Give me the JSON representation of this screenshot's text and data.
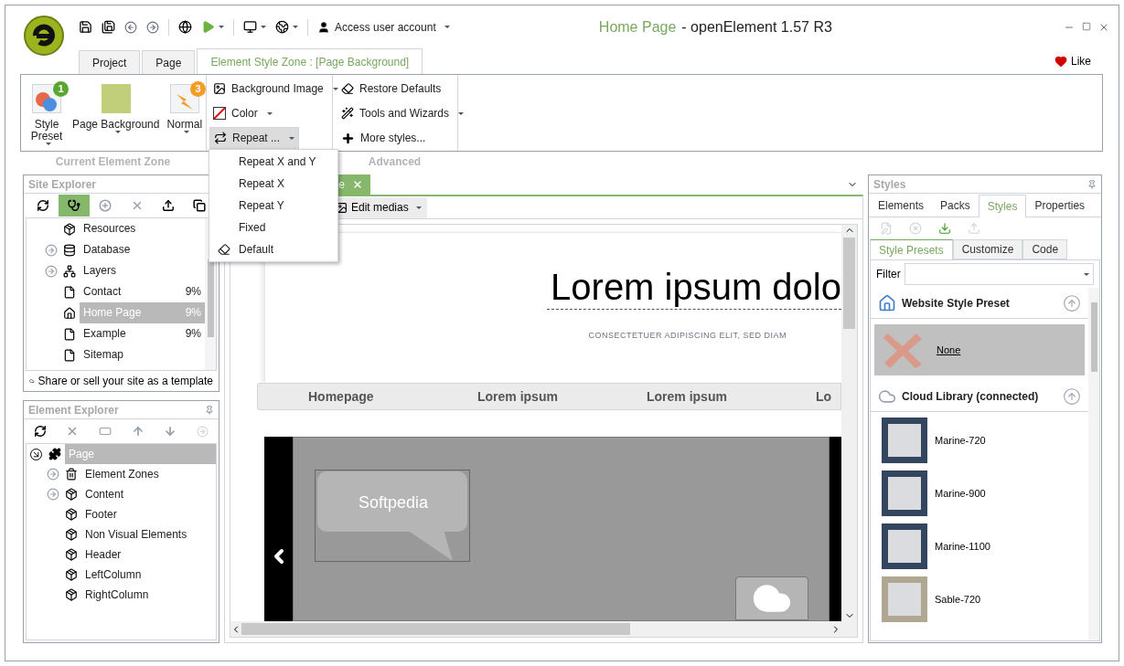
{
  "title": {
    "page": "Home Page",
    "app": "- openElement 1.57 R3"
  },
  "toolbar": {
    "account": "Access user account"
  },
  "tabs": [
    {
      "label": "Project",
      "selected": false
    },
    {
      "label": "Page",
      "selected": false
    },
    {
      "label": "Element Style Zone : [Page Background]",
      "selected": true
    }
  ],
  "like": "Like",
  "ribbon": {
    "big_buttons": [
      {
        "kind": "preset",
        "label": "Style Preset",
        "badge": "1"
      },
      {
        "kind": "swatch",
        "label": "Page Background"
      },
      {
        "kind": "normal",
        "label": "Normal",
        "badge": "3"
      }
    ],
    "style_buttons": [
      {
        "kind": "image",
        "label": "Background Image",
        "pressed": false
      },
      {
        "kind": "color",
        "label": "Color",
        "pressed": false
      },
      {
        "kind": "repeat",
        "label": "Repeat ...",
        "pressed": true
      }
    ],
    "advanced_buttons": [
      {
        "kind": "eraser",
        "label": "Restore Defaults"
      },
      {
        "kind": "wand",
        "label": "Tools and Wizards"
      },
      {
        "kind": "plus",
        "label": "More styles..."
      }
    ],
    "group_labels": [
      "Current Element Zone",
      "Advanced"
    ]
  },
  "repeat_menu": [
    {
      "kind": "plain",
      "label": "Repeat X and Y"
    },
    {
      "kind": "plain",
      "label": "Repeat X"
    },
    {
      "kind": "plain",
      "label": "Repeat Y"
    },
    {
      "kind": "plain",
      "label": "Fixed"
    },
    {
      "kind": "icon",
      "label": "Default"
    }
  ],
  "site_explorer": {
    "title": "Site Explorer",
    "toolbar": [
      {
        "kind": "refresh",
        "selected": false,
        "disabled": false
      },
      {
        "kind": "stethoscope",
        "selected": true,
        "disabled": false
      },
      {
        "kind": "add",
        "selected": false,
        "disabled": true
      },
      {
        "kind": "delete",
        "selected": false,
        "disabled": true
      },
      {
        "kind": "upload",
        "selected": false,
        "disabled": false
      },
      {
        "kind": "copy",
        "selected": false,
        "disabled": false
      }
    ],
    "items": [
      {
        "kind": "resources",
        "label": "Resources",
        "expandable": false,
        "selected": false
      },
      {
        "kind": "database",
        "label": "Database",
        "expandable": true,
        "expanded": false,
        "selected": false
      },
      {
        "kind": "layers",
        "label": "Layers",
        "expandable": true,
        "expanded": false,
        "selected": false
      },
      {
        "kind": "page",
        "label": "Contact",
        "percent": "9%",
        "expandable": false,
        "selected": false
      },
      {
        "kind": "home",
        "label": "Home Page",
        "percent": "9%",
        "expandable": false,
        "selected": true
      },
      {
        "kind": "page",
        "label": "Example",
        "percent": "9%",
        "expandable": false,
        "selected": false
      },
      {
        "kind": "sitemap",
        "label": "Sitemap",
        "expandable": false,
        "selected": false
      }
    ],
    "footer": "Share or sell your site as a template"
  },
  "element_explorer": {
    "title": "Element Explorer",
    "tree": [
      {
        "kind": "puzzle",
        "label": "Page",
        "expandable": true,
        "expanded": true,
        "selected": true,
        "children": [
          {
            "kind": "bin",
            "label": "Element Zones",
            "expandable": true,
            "expanded": false,
            "selected": false
          },
          {
            "kind": "box",
            "label": "Content",
            "expandable": true,
            "expanded": false,
            "selected": false
          },
          {
            "kind": "box",
            "label": "Footer",
            "expandable": false,
            "selected": false
          },
          {
            "kind": "box",
            "label": "Non Visual Elements",
            "expandable": false,
            "selected": false
          },
          {
            "kind": "box",
            "label": "Header",
            "expandable": false,
            "selected": false
          },
          {
            "kind": "box",
            "label": "LeftColumn",
            "expandable": false,
            "selected": false
          },
          {
            "kind": "box",
            "label": "RightColumn",
            "expandable": false,
            "selected": false
          }
        ]
      }
    ]
  },
  "editor": {
    "doc_tab": "e",
    "edit_medias": "Edit medias",
    "preview": {
      "heading": "Lorem ipsum dolo",
      "subtitle": "CONSECTETUER ADIPISCING ELIT, SED DIAM",
      "nav": [
        "Homepage",
        "Lorem ipsum",
        "Lorem ipsum",
        "Lo"
      ],
      "bubble": "Softpedia"
    }
  },
  "styles_panel": {
    "title": "Styles",
    "tabs": [
      {
        "label": "Elements",
        "selected": false
      },
      {
        "label": "Packs",
        "selected": false
      },
      {
        "label": "Styles",
        "selected": true
      },
      {
        "label": "Properties",
        "selected": false
      }
    ],
    "toolbar": [
      {
        "kind": "edit",
        "disabled": true
      },
      {
        "kind": "remove",
        "disabled": true
      },
      {
        "kind": "download",
        "disabled": false
      },
      {
        "kind": "upload",
        "disabled": true
      }
    ],
    "subtabs": [
      {
        "label": "Style Presets",
        "selected": true
      },
      {
        "label": "Customize",
        "selected": false
      },
      {
        "label": "Code",
        "selected": false
      }
    ],
    "filter_label": "Filter",
    "sections": [
      {
        "kind": "house",
        "title": "Website Style Preset",
        "items": [
          {
            "kind": "none",
            "name": "None",
            "selected": true
          }
        ]
      },
      {
        "kind": "cloud",
        "title": "Cloud Library (connected)",
        "items": [
          {
            "kind": "swatch",
            "name": "Marine-720",
            "color": "#34465f",
            "selected": false
          },
          {
            "kind": "swatch",
            "name": "Marine-900",
            "color": "#34465f",
            "selected": false
          },
          {
            "kind": "swatch",
            "name": "Marine-1100",
            "color": "#34465f",
            "selected": false
          },
          {
            "kind": "swatch",
            "name": "Sable-720",
            "color": "#b0a792",
            "selected": false
          }
        ]
      }
    ]
  }
}
